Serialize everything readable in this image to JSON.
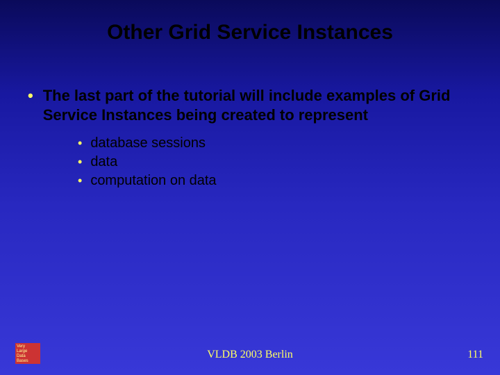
{
  "title": "Other Grid Service Instances",
  "main_bullet": "The last part of the tutorial will include examples of Grid Service Instances being created to represent",
  "sub_bullets": {
    "b0": "database sessions",
    "b1": "data",
    "b2": "computation on data"
  },
  "logo": {
    "l0": "Very",
    "l1": "Large",
    "l2": "Data",
    "l3": "Bases"
  },
  "footer_center": "VLDB 2003 Berlin",
  "page_number": "111"
}
